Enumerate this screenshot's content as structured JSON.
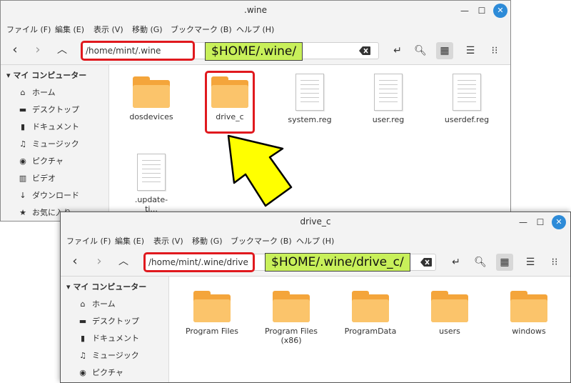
{
  "window1": {
    "title": ".wine",
    "controls": {
      "minimize": "—",
      "maximize": "☐",
      "close": "✕"
    },
    "menu": [
      "ファイル (F)",
      "編集 (E)",
      "表示 (V)",
      "移動 (G)",
      "ブックマーク (B)",
      "ヘルプ (H)"
    ],
    "path": "/home/mint/.wine",
    "callout": "$HOME/.wine/",
    "sidebar": {
      "header": "マイ コンピューター",
      "items": [
        {
          "icon": "home-icon",
          "label": "ホーム"
        },
        {
          "icon": "desktop-icon",
          "label": "デスクトップ"
        },
        {
          "icon": "document-icon",
          "label": "ドキュメント"
        },
        {
          "icon": "music-icon",
          "label": "ミュージック"
        },
        {
          "icon": "camera-icon",
          "label": "ピクチャ"
        },
        {
          "icon": "film-icon",
          "label": "ビデオ"
        },
        {
          "icon": "download-icon",
          "label": "ダウンロード"
        },
        {
          "icon": "star-icon",
          "label": "お気に入り"
        }
      ]
    },
    "files": [
      {
        "type": "folder",
        "name": "dosdevices"
      },
      {
        "type": "folder",
        "name": "drive_c"
      },
      {
        "type": "doc",
        "name": "system.reg"
      },
      {
        "type": "doc",
        "name": "user.reg"
      },
      {
        "type": "doc",
        "name": "userdef.reg"
      },
      {
        "type": "doc",
        "name": ".update-timestamp"
      }
    ],
    "partial_file_label": ".update-\nti..."
  },
  "window2": {
    "title": "drive_c",
    "controls": {
      "minimize": "—",
      "maximize": "☐",
      "close": "✕"
    },
    "menu": [
      "ファイル (F)",
      "編集 (E)",
      "表示 (V)",
      "移動 (G)",
      "ブックマーク (B)",
      "ヘルプ (H)"
    ],
    "path": "/home/mint/.wine/drive_c",
    "callout": "$HOME/.wine/drive_c/",
    "sidebar": {
      "header": "マイ コンピューター",
      "items": [
        {
          "icon": "home-icon",
          "label": "ホーム"
        },
        {
          "icon": "desktop-icon",
          "label": "デスクトップ"
        },
        {
          "icon": "document-icon",
          "label": "ドキュメント"
        },
        {
          "icon": "music-icon",
          "label": "ミュージック"
        },
        {
          "icon": "camera-icon",
          "label": "ピクチャ"
        }
      ]
    },
    "files": [
      {
        "type": "folder",
        "name": "Program Files"
      },
      {
        "type": "folder",
        "name": "Program Files (x86)"
      },
      {
        "type": "folder",
        "name": "ProgramData"
      },
      {
        "type": "folder",
        "name": "users"
      },
      {
        "type": "folder",
        "name": "windows"
      }
    ]
  },
  "colors": {
    "highlight_red": "#e0191e",
    "callout_green": "#c8f05a",
    "arrow_yellow": "#ffff00",
    "folder_orange": "#f4a53b",
    "close_blue": "#2d8bd8"
  }
}
